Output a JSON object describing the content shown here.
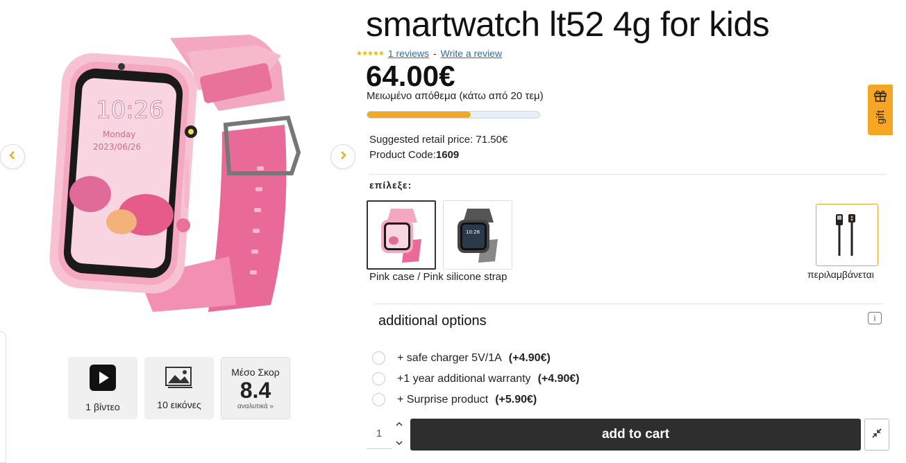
{
  "product": {
    "title": "smartwatch lt52 4g for kids",
    "stars": "★★★★★",
    "reviews_link": "1 reviews",
    "separator": "-",
    "write_review": "Write a review",
    "price": "64.00€",
    "stock_text": "Μειωμένο απόθεμα (κάτω από 20 τεμ)",
    "stock_level_fraction": 0.6,
    "suggested_price_label": "Suggested retail price: ",
    "suggested_price_value": "71.50€",
    "code_label": "Product Code:",
    "code_value": "1609"
  },
  "gallery": {
    "video_label": "1 βίντεο",
    "images_label": "10 εικόνες",
    "score_title": "Μέσο Σκορ",
    "score_value": "8.4",
    "score_link": "αναλυτικά »"
  },
  "variants": {
    "label": "επίλεξε:",
    "selected_caption": "Pink case / Pink silicone strap",
    "included_caption": "περιλαμβάνεται"
  },
  "additional": {
    "title": "additional options",
    "info_icon": "i",
    "options": [
      {
        "label": "+ safe charger 5V/1A",
        "price": "(+4.90€)"
      },
      {
        "label": "+1 year additional warranty",
        "price": "(+4.90€)"
      },
      {
        "label": "+ Surprise product",
        "price": "(+5.90€)"
      }
    ]
  },
  "cart": {
    "quantity": "1",
    "add_to_cart": "add to cart"
  },
  "gift_tab": {
    "label": "gift"
  },
  "colors": {
    "accent": "#f5a623",
    "dark_button": "#2e2e2e",
    "link": "#2a6fa8",
    "watch_pink": "#f07fa5"
  }
}
